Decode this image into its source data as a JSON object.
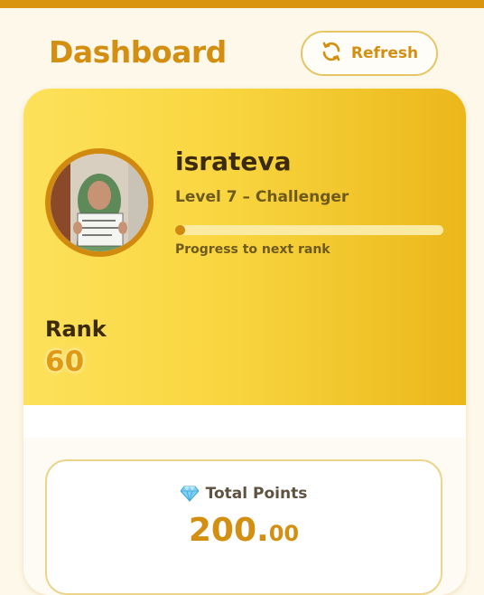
{
  "header": {
    "title": "Dashboard",
    "refresh_label": "Refresh",
    "refresh_icon": "refresh-icon"
  },
  "profile": {
    "username": "israteva",
    "level_label": "Level 7 – Challenger",
    "progress_label": "Progress to next rank",
    "progress_fraction": 0.03,
    "avatar_icon": "user-photo"
  },
  "rank": {
    "label": "Rank",
    "value": "60"
  },
  "points": {
    "title": "Total Points",
    "icon": "gem-icon",
    "value_int": "200.",
    "value_dec": "00"
  },
  "colors": {
    "accent": "#d38f12",
    "card_gradient_start": "#fde15a",
    "card_gradient_end": "#ebb71b",
    "progress_fill": "#d08a10",
    "progress_track": "#fbeaa2"
  }
}
